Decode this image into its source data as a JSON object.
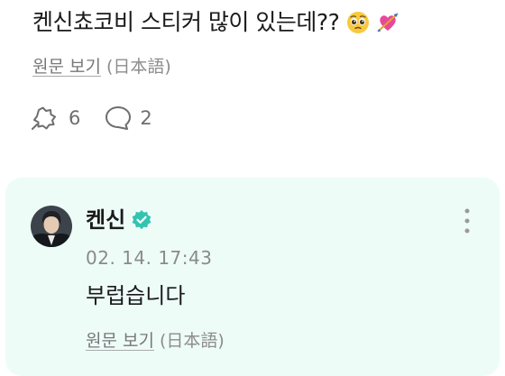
{
  "post": {
    "text": "켄신쵸코비 스티커 많이 있는데??",
    "emojis": [
      "pleading-face-emoji",
      "heart-with-arrow-emoji"
    ],
    "translate_label": "원문 보기",
    "translate_lang": "(日本語)",
    "like_count": "6",
    "comment_count": "2"
  },
  "comment": {
    "author": "켄신",
    "verified": true,
    "timestamp": "02. 14. 17:43",
    "text": "부럽습니다",
    "translate_label": "원문 보기",
    "translate_lang": "(日本語)"
  },
  "colors": {
    "card_bg": "#eefcf8",
    "verified_badge": "#33c4b0",
    "muted_text": "#8a8a8a"
  }
}
